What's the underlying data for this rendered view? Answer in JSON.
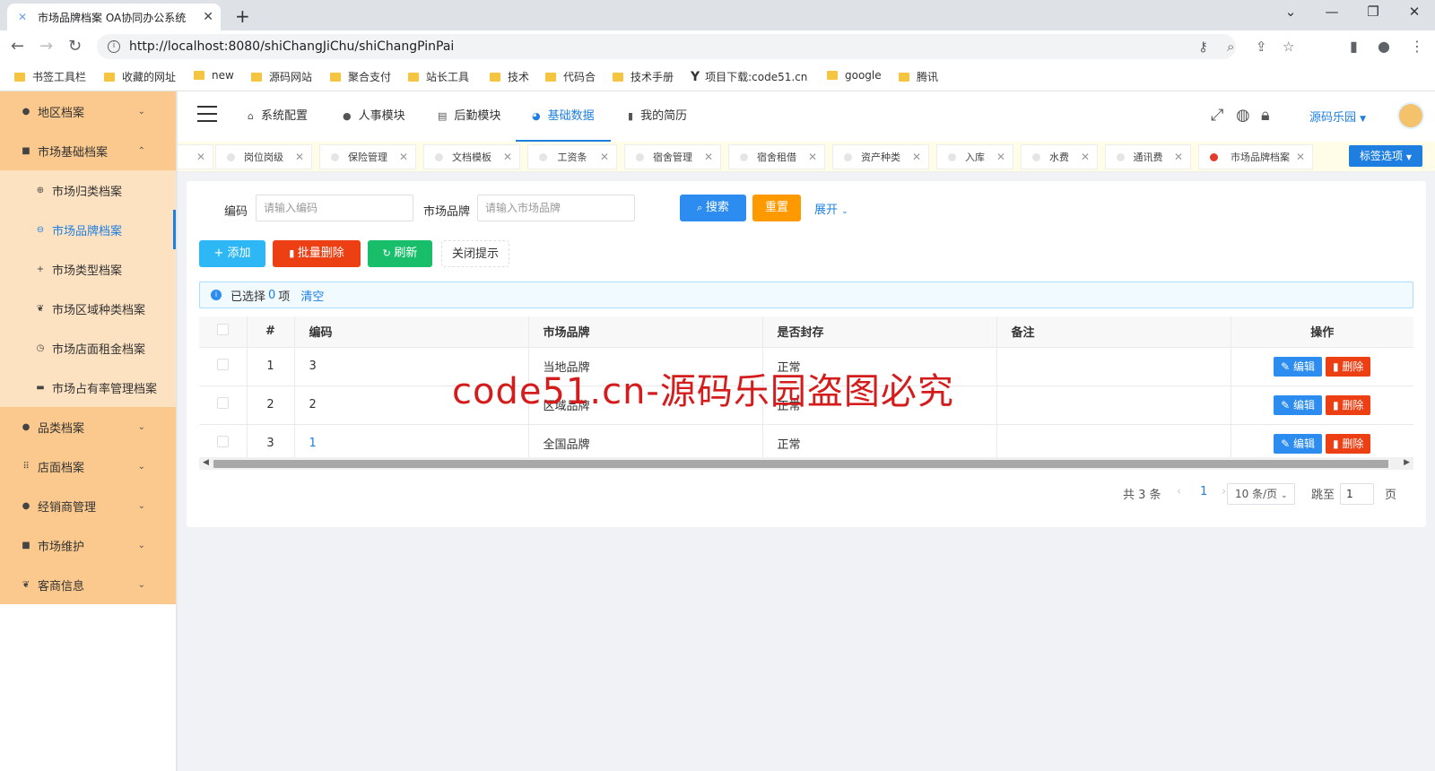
{
  "browser": {
    "tab_title": "市场品牌档案 OA协同办公系统",
    "url": "http://localhost:8080/shiChangJiChu/shiChangPinPai",
    "bookmarks": [
      "书签工具栏",
      "收藏的网址",
      "new",
      "源码网站",
      "聚合支付",
      "站长工具",
      "技术",
      "代码合",
      "技术手册",
      "项目下载:code51.cn",
      "google",
      "腾讯"
    ]
  },
  "sidebar": {
    "groups": [
      {
        "label": "地区档案",
        "icon": "circle-icon"
      },
      {
        "label": "市场基础档案",
        "icon": "folder-icon"
      },
      {
        "label": "品类档案",
        "icon": "circle-icon"
      },
      {
        "label": "店面档案",
        "icon": "grid-icon"
      },
      {
        "label": "经销商管理",
        "icon": "circle-icon"
      },
      {
        "label": "市场维护",
        "icon": "folder-icon"
      },
      {
        "label": "客商信息",
        "icon": "cat-icon"
      }
    ],
    "sub_items": [
      {
        "label": "市场归类档案"
      },
      {
        "label": "市场品牌档案"
      },
      {
        "label": "市场类型档案"
      },
      {
        "label": "市场区域种类档案"
      },
      {
        "label": "市场店面租金档案"
      },
      {
        "label": "市场占有率管理档案"
      }
    ]
  },
  "header": {
    "nav": [
      {
        "label": "系统配置",
        "icon": "home-icon"
      },
      {
        "label": "人事模块",
        "icon": "user-icon"
      },
      {
        "label": "后勤模块",
        "icon": "box-icon"
      },
      {
        "label": "基础数据",
        "icon": "pie-icon"
      },
      {
        "label": "我的简历",
        "icon": "book-icon"
      }
    ],
    "user": "源码乐园"
  },
  "page_tabs": {
    "tabs": [
      "岗位岗级",
      "保险管理",
      "文档模板",
      "工资条",
      "宿舍管理",
      "宿舍租借",
      "资产种类",
      "入库",
      "水费",
      "通讯费",
      "市场品牌档案"
    ],
    "options_label": "标签选项"
  },
  "search": {
    "code_label": "编码",
    "code_placeholder": "请输入编码",
    "brand_label": "市场品牌",
    "brand_placeholder": "请输入市场品牌",
    "search_btn": "搜索",
    "reset_btn": "重置",
    "expand": "展开"
  },
  "toolbar": {
    "add": "添加",
    "bulk_delete": "批量删除",
    "refresh": "刷新",
    "close_tip": "关闭提示"
  },
  "alert": {
    "prefix": "已选择",
    "count": "0",
    "suffix": "项",
    "clear": "清空"
  },
  "table": {
    "columns": [
      "#",
      "编码",
      "市场品牌",
      "是否封存",
      "备注",
      "操作"
    ],
    "rows": [
      {
        "index": "1",
        "code": "3",
        "brand": "当地品牌",
        "status": "正常",
        "remark": ""
      },
      {
        "index": "2",
        "code": "2",
        "brand": "区域品牌",
        "status": "正常",
        "remark": ""
      },
      {
        "index": "3",
        "code": "1",
        "brand": "全国品牌",
        "status": "正常",
        "remark": ""
      }
    ],
    "edit_label": "编辑",
    "delete_label": "删除"
  },
  "pagination": {
    "total": "共 3 条",
    "current": "1",
    "page_size": "10 条/页",
    "jump_label": "跳至",
    "jump_value": "1",
    "page_suffix": "页"
  },
  "watermark": "code51.cn-源码乐园盗图必究"
}
